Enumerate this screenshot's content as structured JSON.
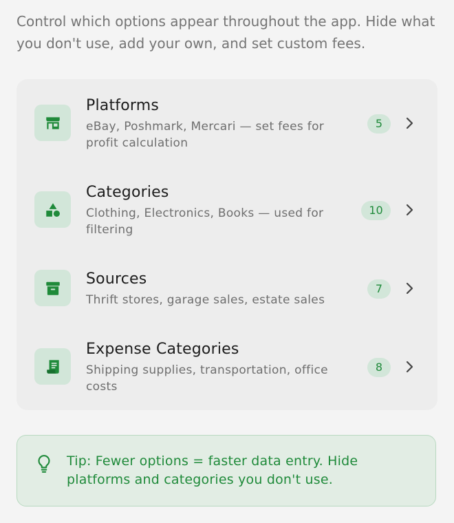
{
  "intro_text": "Control which options appear throughout the app. Hide what you don't use, add your own, and set custom fees.",
  "settings": {
    "items": [
      {
        "title": "Platforms",
        "description": "eBay, Poshmark, Mercari — set fees for profit calculation",
        "count": "5",
        "icon": "storefront-icon"
      },
      {
        "title": "Categories",
        "description": "Clothing, Electronics, Books — used for filtering",
        "count": "10",
        "icon": "shapes-icon"
      },
      {
        "title": "Sources",
        "description": "Thrift stores, garage sales, estate sales",
        "count": "7",
        "icon": "archive-box-icon"
      },
      {
        "title": "Expense Categories",
        "description": "Shipping supplies, transportation, office costs",
        "count": "8",
        "icon": "receipt-icon"
      }
    ]
  },
  "tip": {
    "text": "Tip: Fewer options = faster data entry. Hide platforms and categories you don't use.",
    "icon": "lightbulb-icon"
  },
  "colors": {
    "accent_green": "#1f8a3a",
    "badge_bg": "#d2e6d9",
    "tip_bg": "#e2ede4"
  }
}
